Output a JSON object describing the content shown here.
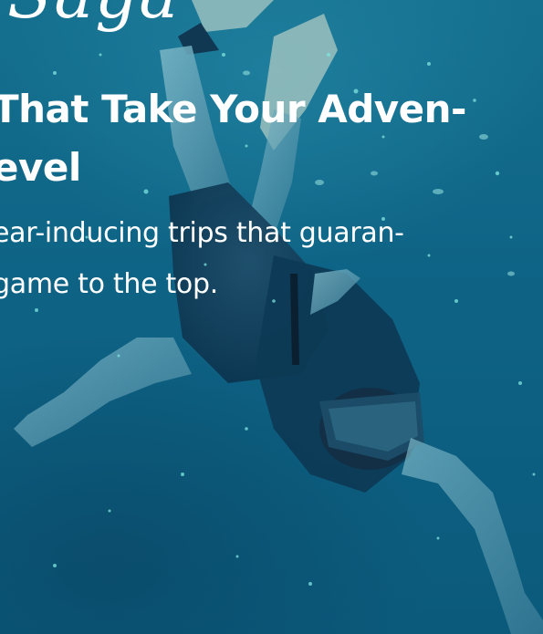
{
  "hero": {
    "title_fragment": "Saga",
    "headline_lines": [
      "That Take Your Adven-",
      "evel"
    ],
    "subtext_lines": [
      "ear-inducing trips that guaran-",
      "game to the top."
    ]
  },
  "colors": {
    "text": "#ffffff",
    "water": "#0f6a8c",
    "particles": "#7fe6df"
  },
  "background_image": {
    "subject": "snorkeler diving underwater wearing mask, snorkel and fins"
  }
}
